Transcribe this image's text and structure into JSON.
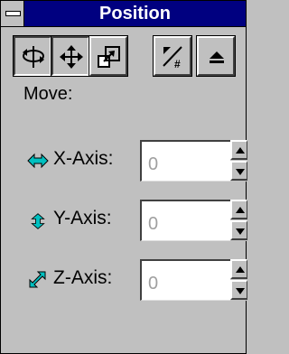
{
  "window": {
    "title": "Position"
  },
  "toolbar": {
    "buttons": [
      {
        "icon": "rotate-icon",
        "pressed": true
      },
      {
        "icon": "move-icon",
        "pressed": true
      },
      {
        "icon": "scale-icon",
        "pressed": false
      },
      {
        "icon": "percent-icon",
        "pressed": false
      },
      {
        "icon": "eject-icon",
        "pressed": false
      }
    ]
  },
  "mode": {
    "label": "Move:"
  },
  "axes": [
    {
      "label": "X-Axis:",
      "value": "0",
      "icon": "x-arrows-icon"
    },
    {
      "label": "Y-Axis:",
      "value": "0",
      "icon": "y-arrows-icon"
    },
    {
      "label": "Z-Axis:",
      "value": "0",
      "icon": "z-arrows-icon"
    }
  ],
  "colors": {
    "titlebar": "#000080",
    "face": "#c0c0c0",
    "axis_icon_cyan": "#00c0c0"
  }
}
